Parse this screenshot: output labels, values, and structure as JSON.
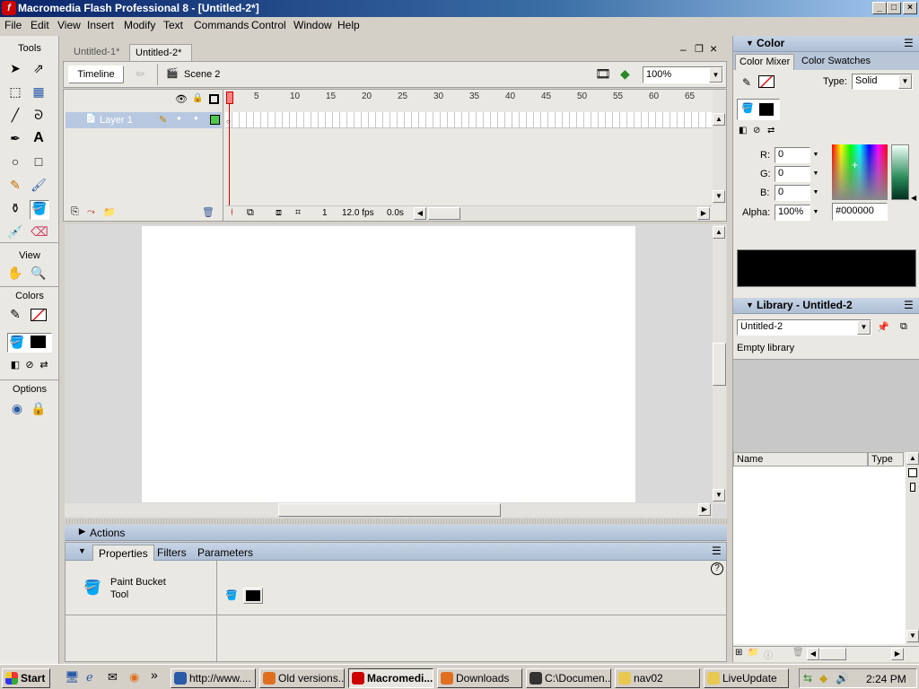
{
  "window": {
    "title": "Macromedia Flash Professional 8 - [Untitled-2*]"
  },
  "menu": [
    "File",
    "Edit",
    "View",
    "Insert",
    "Modify",
    "Text",
    "Commands",
    "Control",
    "Window",
    "Help"
  ],
  "tools": {
    "title": "Tools",
    "view_label": "View",
    "colors_label": "Colors",
    "options_label": "Options"
  },
  "doc_tabs": [
    "Untitled-1*",
    "Untitled-2*"
  ],
  "timeline": {
    "button": "Timeline",
    "scene": "Scene 2",
    "zoom": "100%",
    "layer": "Layer 1",
    "frame_numbers": [
      "1",
      "5",
      "10",
      "15",
      "20",
      "25",
      "30",
      "35",
      "40",
      "45",
      "50",
      "55",
      "60",
      "65"
    ],
    "current_frame": "1",
    "fps": "12.0 fps",
    "time": "0.0s"
  },
  "bottom_panels": {
    "actions": "Actions",
    "tabs": [
      "Properties",
      "Filters",
      "Parameters"
    ],
    "tool_name_line1": "Paint Bucket",
    "tool_name_line2": "Tool"
  },
  "color_panel": {
    "title": "Color",
    "tabs": [
      "Color Mixer",
      "Color Swatches"
    ],
    "type_label": "Type:",
    "type_value": "Solid",
    "r_label": "R:",
    "r": "0",
    "g_label": "G:",
    "g": "0",
    "b_label": "B:",
    "b": "0",
    "alpha_label": "Alpha:",
    "alpha": "100%",
    "hex": "#000000",
    "fill_color": "#000000"
  },
  "library": {
    "title": "Library - Untitled-2",
    "selected": "Untitled-2",
    "status": "Empty library",
    "col_name": "Name",
    "col_type": "Type"
  },
  "taskbar": {
    "start": "Start",
    "items": [
      "http://www....",
      "Old versions...",
      "Macromedi...",
      "Downloads",
      "C:\\Documen...",
      "nav02",
      "LiveUpdate"
    ],
    "clock": "2:24 PM"
  },
  "colors": {
    "accent": "#0a246a",
    "header": "#aebed4",
    "stage": "#ffffff",
    "playhead": "#cc0000"
  }
}
